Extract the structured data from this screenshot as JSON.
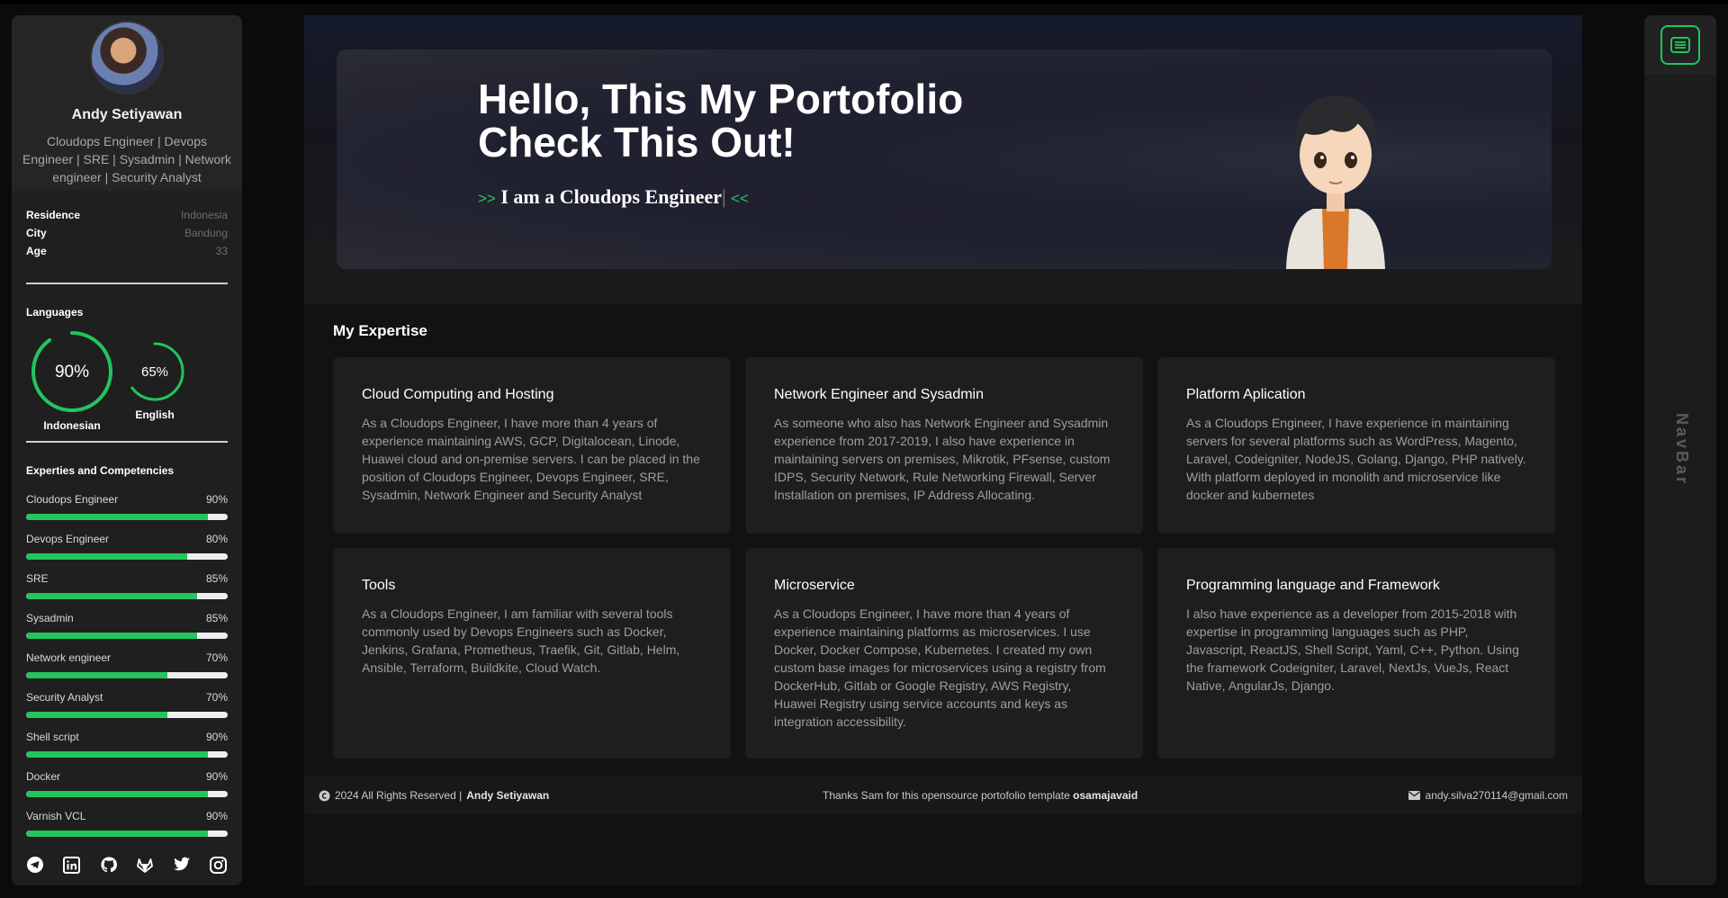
{
  "profile": {
    "name": "Andy Setiyawan",
    "role": "Cloudops Engineer | Devops Engineer | SRE | Sysadmin | Network engineer | Security Analyst"
  },
  "info": [
    {
      "key": "Residence",
      "value": "Indonesia"
    },
    {
      "key": "City",
      "value": "Bandung"
    },
    {
      "key": "Age",
      "value": "33"
    }
  ],
  "languages": {
    "title": "Languages",
    "items": [
      {
        "name": "Indonesian",
        "percent": 90,
        "label": "90%"
      },
      {
        "name": "English",
        "percent": 65,
        "label": "65%"
      }
    ]
  },
  "skills": {
    "title": "Experties and Competencies",
    "items": [
      {
        "name": "Cloudops Engineer",
        "label": "90%",
        "percent": 90
      },
      {
        "name": "Devops Engineer",
        "label": "80%",
        "percent": 80
      },
      {
        "name": "SRE",
        "label": "85%",
        "percent": 85
      },
      {
        "name": "Sysadmin",
        "label": "85%",
        "percent": 85
      },
      {
        "name": "Network engineer",
        "label": "70%",
        "percent": 70
      },
      {
        "name": "Security Analyst",
        "label": "70%",
        "percent": 70
      },
      {
        "name": "Shell script",
        "label": "90%",
        "percent": 90
      },
      {
        "name": "Docker",
        "label": "90%",
        "percent": 90
      },
      {
        "name": "Varnish VCL",
        "label": "90%",
        "percent": 90
      }
    ]
  },
  "socials": [
    "telegram-icon",
    "linkedin-icon",
    "github-icon",
    "gitlab-icon",
    "twitter-icon",
    "instagram-icon"
  ],
  "hero": {
    "title_line1": "Hello, This My Portofolio",
    "title_line2": "Check This Out!",
    "prefix": ">>",
    "typed": "I am a Cloudops Engineer",
    "suffix": "<<"
  },
  "expertise": {
    "title": "My Expertise",
    "cards": [
      {
        "title": "Cloud Computing and Hosting",
        "text": "As a Cloudops Engineer, I have more than 4 years of experience maintaining AWS, GCP, Digitalocean, Linode, Huawei cloud and on-premise servers. I can be placed in the position of Cloudops Engineer, Devops Engineer, SRE, Sysadmin, Network Engineer and Security Analyst"
      },
      {
        "title": "Network Engineer and Sysadmin",
        "text": "As someone who also has Network Engineer and Sysadmin experience from 2017-2019, I also have experience in maintaining servers on premises, Mikrotik, PFsense, custom IDPS, Security Network, Rule Networking Firewall, Server Installation on premises, IP Address Allocating."
      },
      {
        "title": "Platform Aplication",
        "text": "As a Cloudops Engineer, I have experience in maintaining servers for several platforms such as WordPress, Magento, Laravel, Codeigniter, NodeJS, Golang, Django, PHP natively. With platform deployed in monolith and microservice like docker and kubernetes"
      },
      {
        "title": "Tools",
        "text": "As a Cloudops Engineer, I am familiar with several tools commonly used by Devops Engineers such as Docker, Jenkins, Grafana, Prometheus, Traefik, Git, Gitlab, Helm, Ansible, Terraform, Buildkite, Cloud Watch."
      },
      {
        "title": "Microservice",
        "text": "As a Cloudops Engineer, I have more than 4 years of experience maintaining platforms as microservices. I use Docker, Docker Compose, Kubernetes. I created my own custom base images for microservices using a registry from DockerHub, Gitlab or Google Registry, AWS Registry, Huawei Registry using service accounts and keys as integration accessibility."
      },
      {
        "title": "Programming language and Framework",
        "text": "I also have experience as a developer from 2015-2018 with expertise in programming languages such as PHP, Javascript, ReactJS, Shell Script, Yaml, C++, Python. Using the framework Codeigniter, Laravel, NextJs, VueJs, React Native, AngularJs, Django."
      }
    ]
  },
  "footer": {
    "copyright": "2024 All Rights Reserved |",
    "author": "Andy Setiyawan",
    "thanks": "Thanks Sam for this opensource portofolio template",
    "template_author": "osamajavaid",
    "email": "andy.silva270114@gmail.com"
  },
  "navbar": {
    "label": "NavBar"
  },
  "colors": {
    "accent": "#22c55e",
    "sidebar": "#1f1f1f",
    "card": "#1e1e1e"
  }
}
